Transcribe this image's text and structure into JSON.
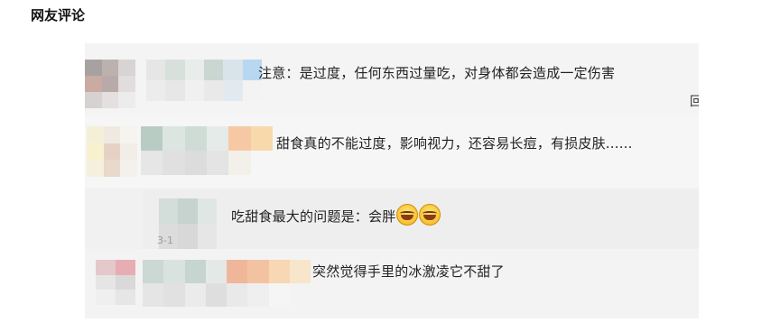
{
  "section": {
    "title": "网友评论"
  },
  "comments": [
    {
      "text": "注意：是过度，任何东西过量吃，对身体都会造成一定伤害",
      "side_fragment": "回"
    },
    {
      "text": "甜食真的不能过度，影响视力，还容易长痘，有损皮肤......"
    },
    {
      "text": "吃甜食最大的问题是：会胖",
      "emoji": [
        "laugh-cry-icon",
        "laugh-cry-icon"
      ],
      "time_fragment": "3-1"
    },
    {
      "text": "突然觉得手里的冰激凌它不甜了"
    }
  ]
}
